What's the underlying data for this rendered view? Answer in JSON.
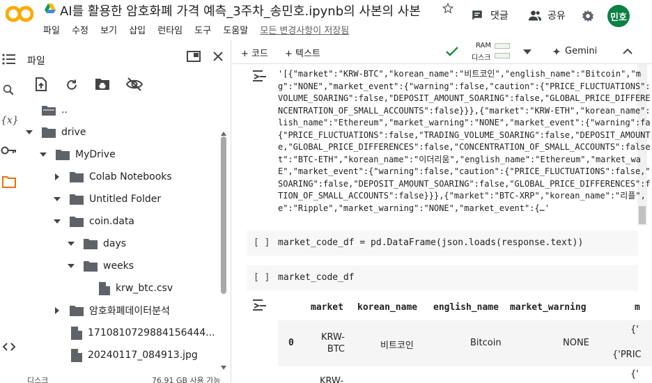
{
  "header": {
    "logo_text": "CO",
    "title": "AI를 활용한 암호화폐 가격 예측_3주차_송민호.ipynb의 사본의 사본",
    "menu": [
      "파일",
      "수정",
      "보기",
      "삽입",
      "런타임",
      "도구",
      "도움말"
    ],
    "saved_status": "모든 변경사항이 저장됨",
    "comment_label": "댓글",
    "share_label": "공유",
    "avatar_text": "민호"
  },
  "sidebar": {
    "title": "파일",
    "tree": [
      {
        "label": "..",
        "kind": "folder-up"
      },
      {
        "label": "drive",
        "kind": "folder",
        "expanded": true
      },
      {
        "label": "MyDrive",
        "kind": "folder",
        "expanded": true
      },
      {
        "label": "Colab Notebooks",
        "kind": "folder",
        "expanded": false
      },
      {
        "label": "Untitled Folder",
        "kind": "folder",
        "expanded": true
      },
      {
        "label": "coin.data",
        "kind": "folder",
        "expanded": true
      },
      {
        "label": "days",
        "kind": "folder",
        "expanded": true
      },
      {
        "label": "weeks",
        "kind": "folder",
        "expanded": true
      },
      {
        "label": "krw_btc.csv",
        "kind": "file"
      },
      {
        "label": "암호화폐데이터분석",
        "kind": "folder",
        "expanded": false
      },
      {
        "label": "1710810729884156444...",
        "kind": "file"
      },
      {
        "label": "20240117_084913.jpg",
        "kind": "file"
      }
    ],
    "footer_label": "디스크",
    "footer_value": "76.91 GB 사용 가능"
  },
  "toolbar": {
    "add_code": "+ 코드",
    "add_text": "+ 텍스트",
    "ram_label": "RAM",
    "disk_label": "디스크",
    "gemini_label": "Gemini"
  },
  "output": {
    "lines": [
      "'[{\"market\":\"KRW-BTC\",\"korean_name\":\"비트코인\",\"english_name\":\"Bitcoin\",\"m",
      "g\":\"NONE\",\"market_event\":{\"warning\":false,\"caution\":{\"PRICE_FLUCTUATIONS\":",
      "VOLUME_SOARING\":false,\"DEPOSIT_AMOUNT_SOARING\":false,\"GLOBAL_PRICE_DIFFERE",
      "NCENTRATION_OF_SMALL_ACCOUNTS\":false}}},{\"market\":\"KRW-ETH\",\"korean_name\":",
      "lish_name\":\"Ethereum\",\"market_warning\":\"NONE\",\"market_event\":{\"warning\":fa",
      "{\"PRICE_FLUCTUATIONS\":false,\"TRADING_VOLUME_SOARING\":false,\"DEPOSIT_AMOUNT",
      "e,\"GLOBAL_PRICE_DIFFERENCES\":false,\"CONCENTRATION_OF_SMALL_ACCOUNTS\":false",
      "t\":\"BTC-ETH\",\"korean_name\":\"이더리움\",\"english_name\":\"Ethereum\",\"market_wa",
      "E\",\"market_event\":{\"warning\":false,\"caution\":{\"PRICE_FLUCTUATIONS\":false,\"",
      "SOARING\":false,\"DEPOSIT_AMOUNT_SOARING\":false,\"GLOBAL_PRICE_DIFFERENCES\":f",
      "TION_OF_SMALL_ACCOUNTS\":false}}},{\"market\":\"BTC-XRP\",\"korean_name\":\"리플\",",
      "e\":\"Ripple\",\"market_warning\":\"NONE\",\"market_event\":{…'"
    ]
  },
  "cells": [
    {
      "prompt": "[ ]",
      "code": "market_code_df = pd.DataFrame(json.loads(response.text))"
    },
    {
      "prompt": "[ ]",
      "code": "market_code_df"
    }
  ],
  "table": {
    "columns": [
      "",
      "market",
      "korean_name",
      "english_name",
      "market_warning",
      "m"
    ],
    "rows": [
      {
        "index": "0",
        "market_1": "KRW-",
        "market_2": "BTC",
        "korean_name": "비트코인",
        "english_name": "Bitcoin",
        "market_warning": "NONE",
        "event_1": "{'",
        "event_2": "{'PRIC"
      },
      {
        "index": "",
        "market_1": "KRW-",
        "market_2": "",
        "korean_name": "",
        "english_name": "",
        "market_warning": "",
        "event_1": "{'",
        "event_2": ""
      }
    ]
  },
  "colors": {
    "logo_orange": "#f9ab00",
    "avatar_green": "#0b8043",
    "check_green": "#1e8e3e",
    "folder_gray": "#5f6368"
  }
}
